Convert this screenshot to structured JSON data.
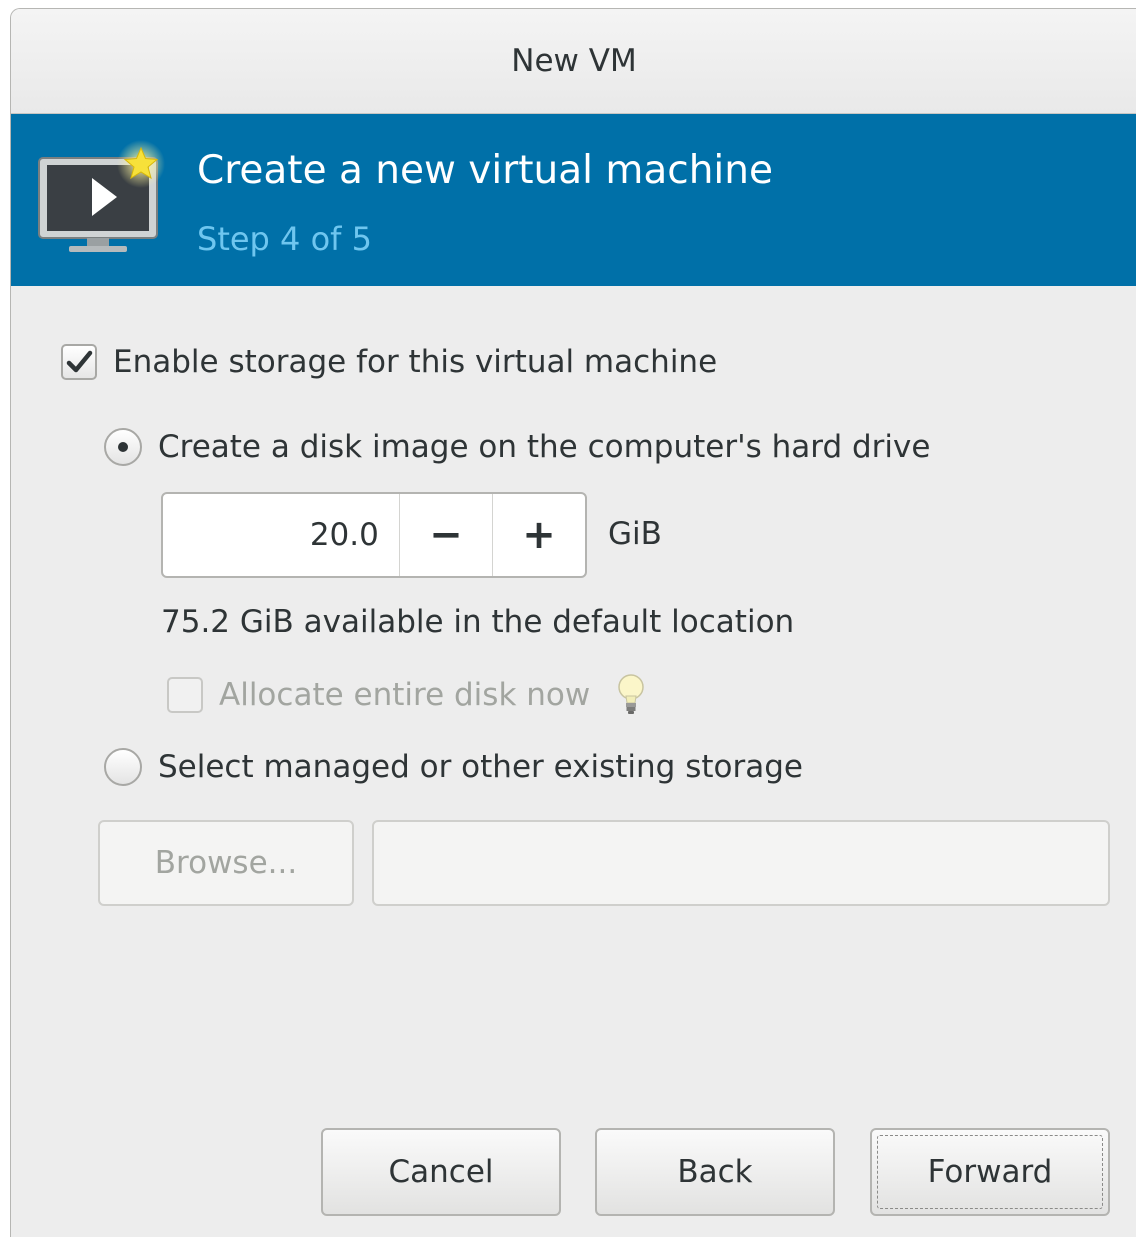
{
  "window": {
    "title": "New VM"
  },
  "banner": {
    "title": "Create a new virtual machine",
    "step": "Step 4 of 5",
    "icon": "vm-monitor-star-icon",
    "background": "#0070a8",
    "step_color": "#6fc6ef"
  },
  "storage": {
    "enable_label": "Enable storage for this virtual machine",
    "enable_checked": true,
    "create_disk_label": "Create a disk image on the computer's hard drive",
    "create_disk_selected": true,
    "size_value": "20.0",
    "decrement_label": "−",
    "increment_label": "+",
    "size_unit": "GiB",
    "available_text": "75.2 GiB available in the default location",
    "allocate_label": "Allocate entire disk now",
    "allocate_checked": false,
    "select_existing_label": "Select managed or other existing storage",
    "select_existing_selected": false,
    "browse_label": "Browse...",
    "path_value": ""
  },
  "buttons": {
    "cancel": "Cancel",
    "back": "Back",
    "forward": "Forward"
  }
}
